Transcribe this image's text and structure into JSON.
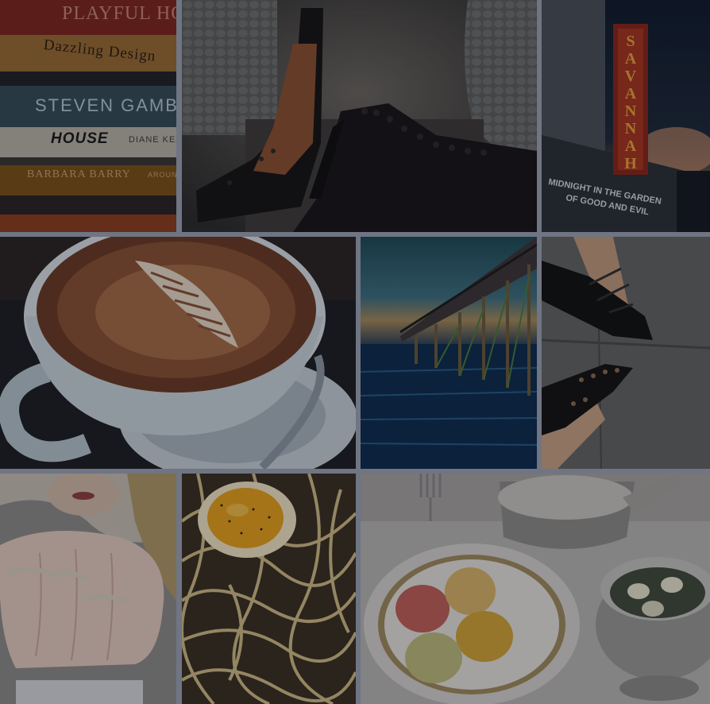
{
  "books": [
    {
      "title": "PLAYFUL HO",
      "color": "#8e2a22",
      "text_color": "#d88c7c"
    },
    {
      "title": "Dazzling Design",
      "color": "#b07a3c",
      "text_color": "#2a1a10"
    },
    {
      "title": "",
      "color": "#2b2b31",
      "text_color": "#ffffff"
    },
    {
      "title": "STEVEN GAMBR",
      "color": "#3d5563",
      "text_color": "#c9d7df"
    },
    {
      "title": "HOUSE",
      "subtitle": "DIANE KEA",
      "color": "#c9c5b8",
      "text_color": "#1a1a1a"
    },
    {
      "title": "BARBARA BARRY",
      "subtitle": "AROUN",
      "color": "#8a5a1e",
      "text_color": "#d6b27a"
    }
  ],
  "theater_sign": {
    "letters": [
      "S",
      "A",
      "V",
      "A",
      "N",
      "N",
      "A",
      "H"
    ],
    "marquee_lines": [
      "MIDNIGHT IN THE GARDEN",
      "OF GOOD AND EVIL"
    ]
  },
  "colors": {
    "gutter": "#6f7583"
  }
}
